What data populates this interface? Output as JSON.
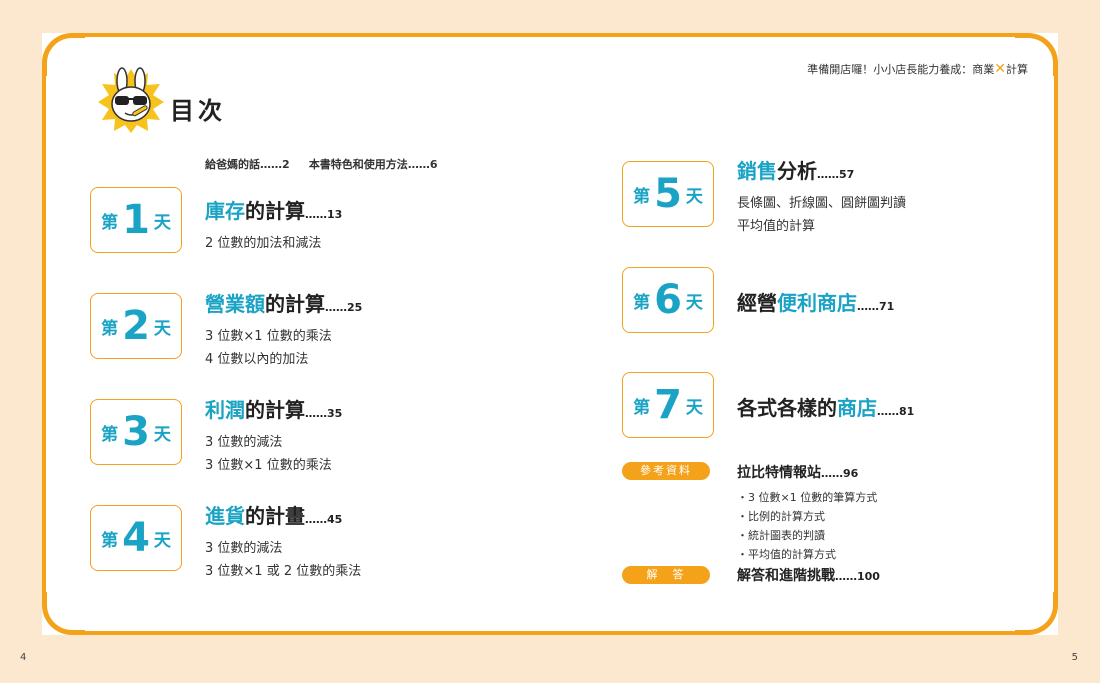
{
  "series_text": "準備開店囉！小小店長能力養成：商業",
  "series_x": "✕",
  "series_tail": "計算",
  "title": "目次",
  "intro": {
    "a_label": "給爸媽的話",
    "a_page": "2",
    "b_label": "本書特色和使用方法",
    "b_page": "6",
    "dots": "……"
  },
  "days": [
    {
      "pre": "第",
      "num": "1",
      "post": "天",
      "kw": "庫存",
      "rest": "的計算",
      "page": "13",
      "subs": [
        "2 位數的加法和減法"
      ]
    },
    {
      "pre": "第",
      "num": "2",
      "post": "天",
      "kw": "營業額",
      "rest": "的計算",
      "page": "25",
      "subs": [
        "3 位數×1 位數的乘法",
        "4 位數以內的加法"
      ]
    },
    {
      "pre": "第",
      "num": "3",
      "post": "天",
      "kw": "利潤",
      "rest": "的計算",
      "page": "35",
      "subs": [
        "3 位數的減法",
        "3 位數×1 位數的乘法"
      ]
    },
    {
      "pre": "第",
      "num": "4",
      "post": "天",
      "kw": "進貨",
      "rest": "的計畫",
      "page": "45",
      "subs": [
        "3 位數的減法",
        "3 位數×1 或 2 位數的乘法"
      ]
    },
    {
      "pre": "第",
      "num": "5",
      "post": "天",
      "kw": "銷售",
      "rest": "分析",
      "page": "57",
      "subs": [
        "長條圖、折線圖、圓餅圖判讀",
        "平均值的計算"
      ]
    },
    {
      "pre": "第",
      "num": "6",
      "post": "天",
      "lead": "經營",
      "kw": "便利商店",
      "rest": "",
      "page": "71",
      "subs": []
    },
    {
      "pre": "第",
      "num": "7",
      "post": "天",
      "lead": "各式各樣的",
      "kw": "商店",
      "rest": "",
      "page": "81",
      "subs": []
    }
  ],
  "reference": {
    "tag": "參考資料",
    "title": "拉比特情報站",
    "page": "96",
    "items": [
      "・3 位數×1 位數的筆算方式",
      "・比例的計算方式",
      "・統計圖表的判讀",
      "・平均值的計算方式"
    ]
  },
  "answers": {
    "tag": "解　答",
    "title": "解答和進階挑戰",
    "page": "100"
  },
  "page_left": "4",
  "page_right": "5",
  "colors": {
    "accent": "#f4a21a",
    "keyword": "#1aa3c4",
    "background": "#fbe8cf"
  }
}
